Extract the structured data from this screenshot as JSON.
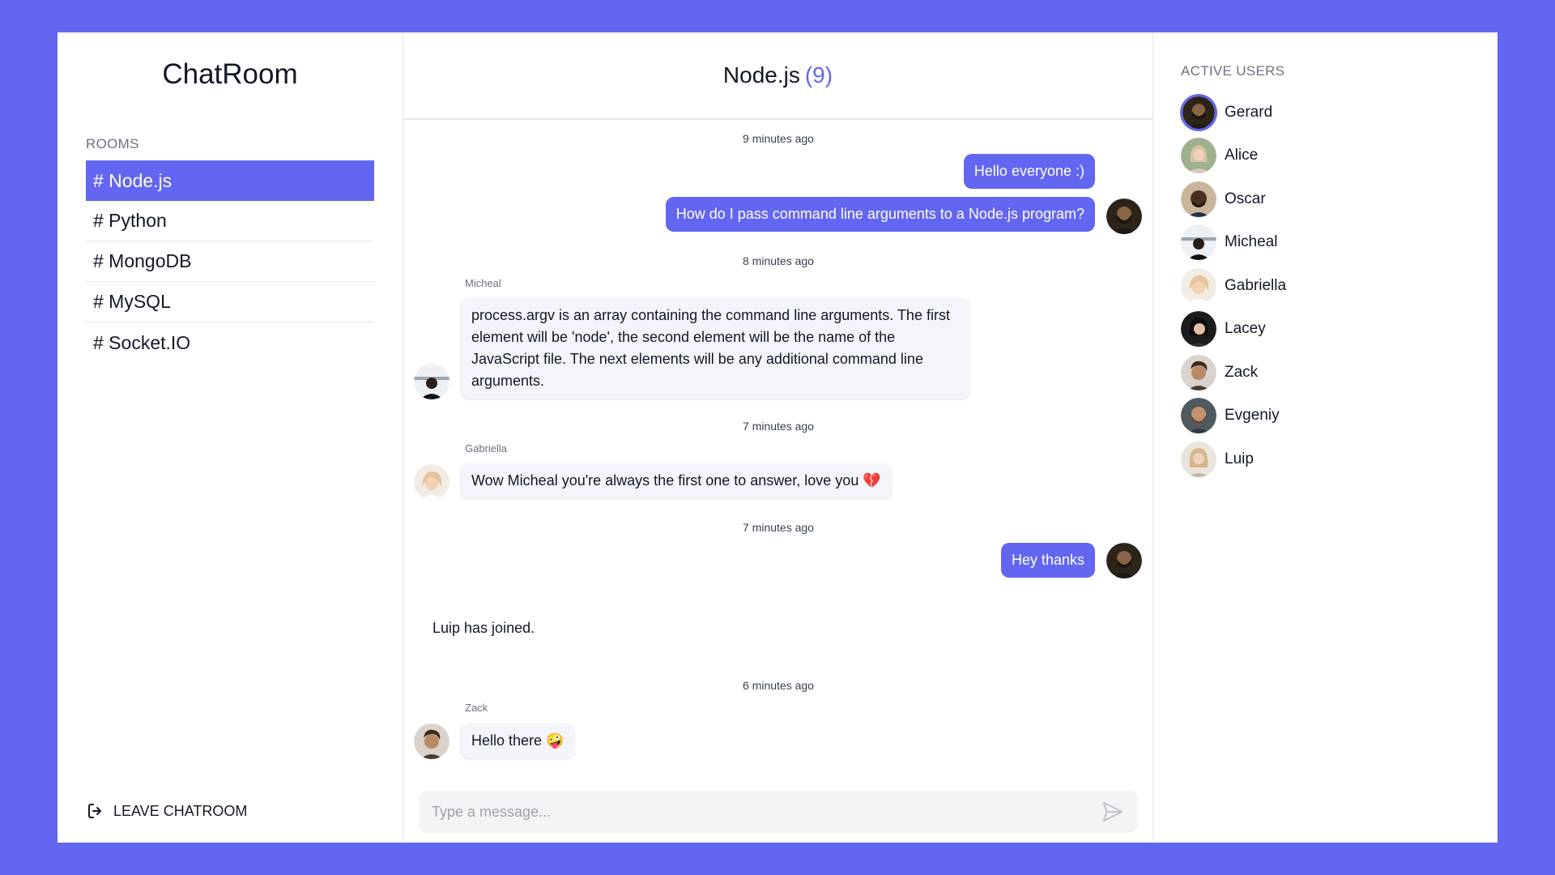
{
  "app": {
    "title": "ChatRoom",
    "accent": "#6366f1"
  },
  "sidebar": {
    "rooms_title": "ROOMS",
    "rooms": [
      {
        "label": "# Node.js",
        "active": true
      },
      {
        "label": "# Python",
        "active": false
      },
      {
        "label": "# MongoDB",
        "active": false
      },
      {
        "label": "# MySQL",
        "active": false
      },
      {
        "label": "# Socket.IO",
        "active": false
      }
    ],
    "leave_label": "LEAVE CHATROOM",
    "leave_icon": "logout-icon"
  },
  "chat": {
    "room_name": "Node.js",
    "user_count": "(9)",
    "messages": [
      {
        "timestamp": "9 minutes ago"
      },
      {
        "text": "Hello everyone :)"
      },
      {
        "text": "How do I pass command line arguments to a Node.js program?"
      },
      {
        "timestamp": "8 minutes ago"
      },
      {
        "sender": "Micheal",
        "text": "process.argv is an array containing the command line arguments. The first element will be 'node', the second element will be the name of the JavaScript file. The next elements will be any additional command line arguments."
      },
      {
        "timestamp": "7 minutes ago"
      },
      {
        "sender": "Gabriella",
        "text": "Wow Micheal you're always the first one to answer, love you 💔"
      },
      {
        "timestamp": "7 minutes ago"
      },
      {
        "text": "Hey thanks"
      },
      {
        "system": "Luip has joined."
      },
      {
        "timestamp": "6 minutes ago"
      },
      {
        "sender": "Zack",
        "text": "Hello there 🤪"
      }
    ],
    "composer_placeholder": "Type a message...",
    "send_icon": "send-icon"
  },
  "users": {
    "title": "ACTIVE USERS",
    "list": [
      {
        "name": "Gerard",
        "color": "#3a2f24",
        "current": true
      },
      {
        "name": "Alice",
        "color": "#b9a38a"
      },
      {
        "name": "Oscar",
        "color": "#4a3528"
      },
      {
        "name": "Micheal",
        "color": "#8e9aa6"
      },
      {
        "name": "Gabriella",
        "color": "#d9b994"
      },
      {
        "name": "Lacey",
        "color": "#2a2a2a"
      },
      {
        "name": "Zack",
        "color": "#5b4a3e"
      },
      {
        "name": "Evgeniy",
        "color": "#6a5a4d"
      },
      {
        "name": "Luip",
        "color": "#d4b48e"
      }
    ]
  }
}
